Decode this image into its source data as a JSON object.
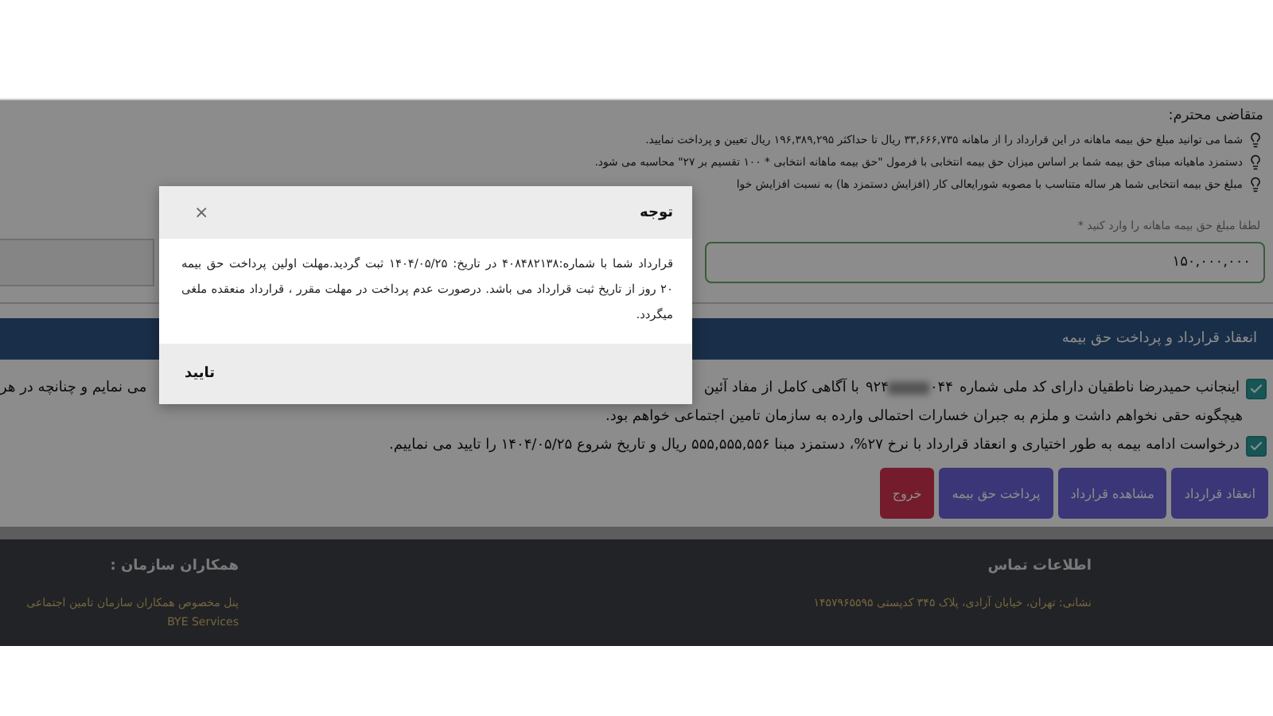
{
  "notice": {
    "heading": "متقاضی محترم:",
    "items": [
      "شما می توانید مبلغ حق بیمه ماهانه در این قرارداد را از ماهانه ۳۳,۶۶۶,۷۳۵ ریال تا حداکثر ۱۹۶,۳۸۹,۲۹۵ ریال تعیین و پرداخت نمایید.",
      "دستمزد ماهیانه مبنای حق بیمه شما بر اساس میزان حق بیمه انتخابی با فرمول \"حق بیمه ماهانه انتخابی * ۱۰۰ تقسیم بر ۲۷\" محاسبه می شود.",
      "مبلغ حق بیمه انتخابی شما هر ساله متناسب با مصوبه شورایعالی کار (افزایش دستمزد ها) به نسبت افزایش خوا"
    ]
  },
  "amount": {
    "label": "لطفا مبلغ حق بیمه ماهانه را وارد کنید *",
    "value": "۱۵۰,۰۰۰,۰۰۰"
  },
  "section": {
    "title": "انعقاد قرارداد و پرداخت حق بیمه"
  },
  "agreement_1": {
    "checked": true,
    "text_before_id": "اینجانب حمیدرضا ناطقیان دارای کد ملی شماره",
    "national_id_start": "۰۴۴",
    "national_id_end": "۹۲۴",
    "text_after_id": "با آگاهی کامل از مفاد آئین",
    "text_end": "می نمایم و چنانچه در هر",
    "line_2": "هیچگونه حقی نخواهم داشت و ملزم به جبران خسارات احتمالی وارده به سازمان تامین اجتماعی خواهم بود."
  },
  "agreement_2": {
    "checked": true,
    "text": "درخواست ادامه بیمه به طور اختیاری و انعقاد قرارداد با نرخ ۲۷%، دستمزد مبنا ۵۵۵,۵۵۵,۵۵۶ ریال و تاریخ شروع ۱۴۰۴/۰۵/۲۵ را تایید می نماییم."
  },
  "buttons": [
    {
      "label": "انعقاد قرارداد",
      "kind": "primary"
    },
    {
      "label": "مشاهده قرارداد",
      "kind": "primary"
    },
    {
      "label": "پرداخت حق بیمه",
      "kind": "primary"
    },
    {
      "label": "خروج",
      "kind": "danger"
    }
  ],
  "footer": {
    "contact": {
      "title": "اطلاعات تماس",
      "address": "نشانی: تهران، خیابان آزادی، پلاک ۳۴۵ کدپستی ۱۴۵۷۹۶۵۵۹۵"
    },
    "partners": {
      "title": "همکاران سازمان :",
      "links": [
        "پنل مخصوص همکاران سازمان تامین اجتماعی",
        "BYE Services"
      ]
    }
  },
  "modal": {
    "title": "توجه",
    "close": "×",
    "body": "قرارداد شما با شماره:۴۰۸۴۸۲۱۳۸ در تاریخ: ۱۴۰۴/۰۵/۲۵ ثبت گردید.مهلت اولین پرداخت حق بیمه ۲۰ روز از تاریخ ثبت قرارداد می باشد. درصورت عدم پرداخت در مهلت مقرر ، قرارداد منعقده ملغی میگردد.",
    "confirm": "تایید"
  }
}
